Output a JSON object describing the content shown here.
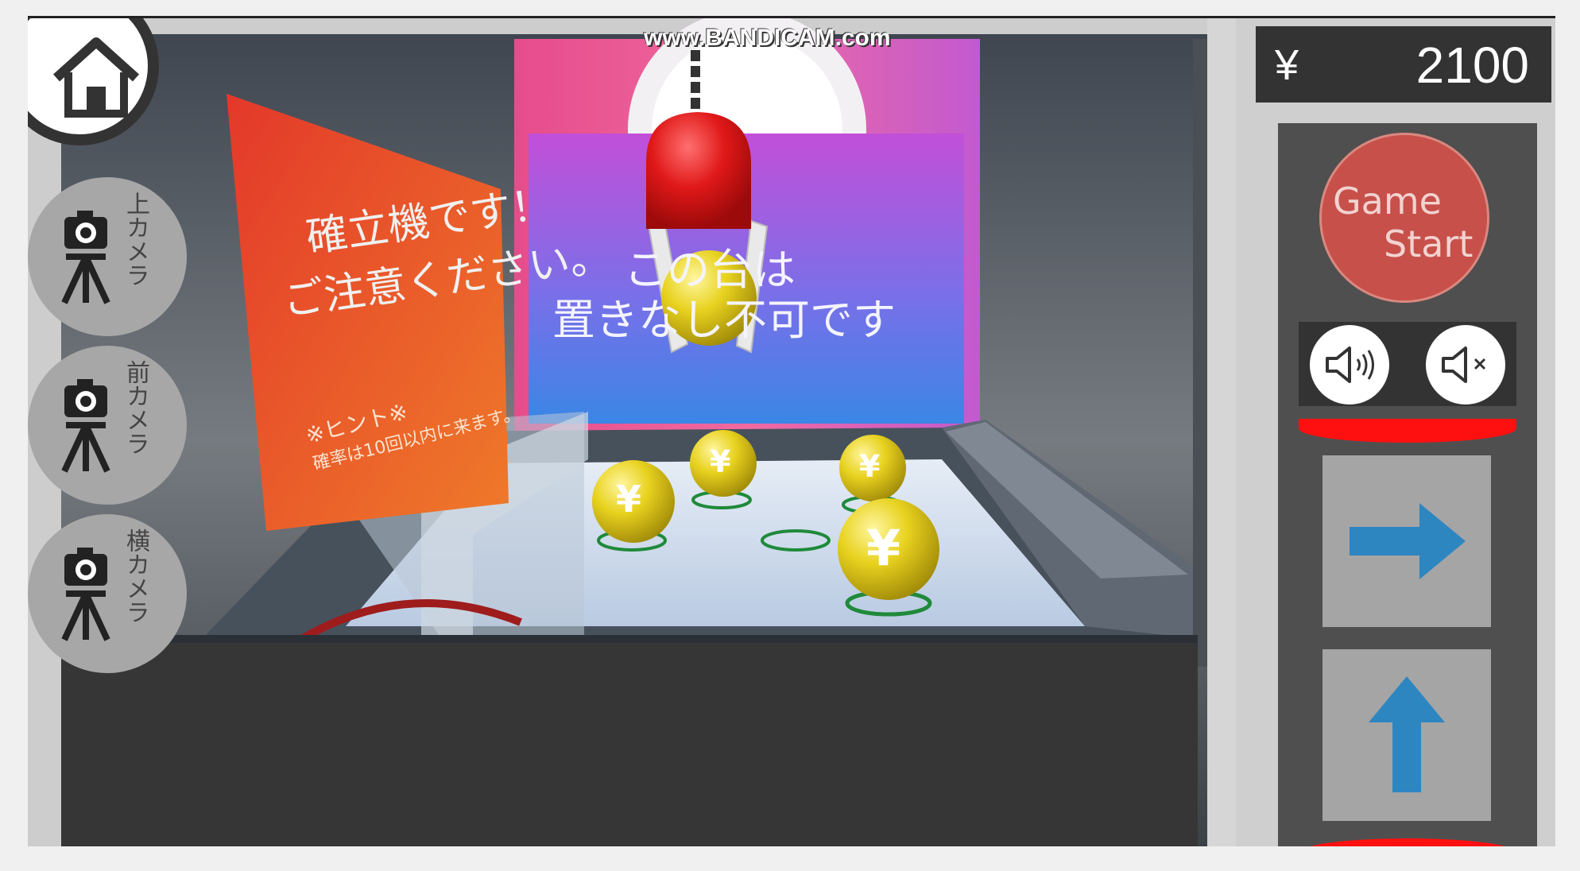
{
  "watermark": "www.BANDICAM.com",
  "sidebar": {
    "home_icon": "home-icon",
    "cameras": [
      {
        "label": "上カメラ",
        "icon": "camera-tripod-icon"
      },
      {
        "label": "前カメラ",
        "icon": "camera-tripod-icon"
      },
      {
        "label": "横カメラ",
        "icon": "camera-tripod-icon"
      }
    ]
  },
  "hud": {
    "currency_symbol": "¥",
    "balance": "2100",
    "start_button": {
      "line1": "Game",
      "line2": "Start"
    },
    "sound_on_icon": "speaker-on-icon",
    "sound_off_icon": "speaker-mute-icon",
    "right_button_icon": "arrow-right-icon",
    "up_button_icon": "arrow-up-icon"
  },
  "scene": {
    "left_sign": {
      "line1": "確立機です！",
      "line2": "ご注意ください。"
    },
    "hint": {
      "title": "※ヒント※",
      "body": "確率は10回以内に来ます。"
    },
    "back_sign": {
      "line1": "この台は",
      "line2": "置きなし不可です"
    },
    "ball_mark": "¥"
  },
  "colors": {
    "accent_red": "#ff1010",
    "arrow_blue": "#2e86c1",
    "start_red": "#c8504a",
    "ball_yellow": "#e8d21f"
  }
}
